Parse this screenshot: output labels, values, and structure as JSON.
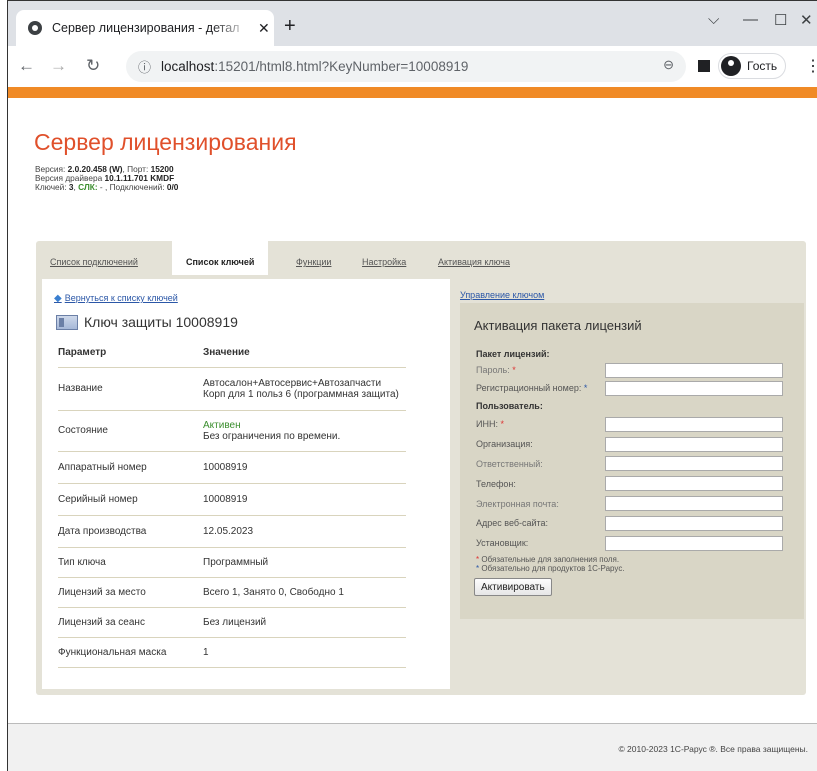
{
  "browser": {
    "tab_title": "Сервер лицензирования - детал",
    "tab_close": "✕",
    "new_tab": "+",
    "url_host": "localhost",
    "url_rest": ":15201/html8.html?KeyNumber=10008919",
    "profile_label": "Гость",
    "icons": [
      "globe-icon",
      "back-icon",
      "forward-icon",
      "reload-icon",
      "info-icon",
      "zoom-icon",
      "side-panel-icon",
      "avatar-icon",
      "menu-icon"
    ]
  },
  "header": {
    "title": "Сервер лицензирования",
    "version_label": "Версия: ",
    "version_value": "2.0.20.458 (W)",
    "port_label": ", Порт: ",
    "port_value": "15200",
    "driver_label": "Версия драйвера ",
    "driver_value": "10.1.11.701 KMDF",
    "keys_label": "Ключей: ",
    "keys_value": "3",
    "slk_label": "СЛК:",
    "slk_value": " - ",
    "conn_label": ", Подключений: ",
    "conn_value": "0/0"
  },
  "tabs": [
    {
      "label": "Список подключений"
    },
    {
      "label": "Список ключей"
    },
    {
      "label": "Функции"
    },
    {
      "label": "Настройка"
    },
    {
      "label": "Активация ключа"
    }
  ],
  "left": {
    "back_link": "Вернуться к списку ключей",
    "key_title": "Ключ защиты 10008919",
    "col_param": "Параметр",
    "col_value": "Значение",
    "rows": [
      {
        "k": "Название",
        "v": "Автосалон+Автосервис+Автозапчасти Корп для 1 польз 6 (программная защита)"
      },
      {
        "k": "Состояние",
        "v_status": "Активен",
        "v": "Без ограничения по времени."
      },
      {
        "k": "Аппаратный номер",
        "v": "10008919"
      },
      {
        "k": "Серийный номер",
        "v": "10008919"
      },
      {
        "k": "Дата производства",
        "v": "12.05.2023"
      },
      {
        "k": "Тип ключа",
        "v": "Программный"
      },
      {
        "k": "Лицензий за место",
        "v": "Всего 1, Занято 0, Свободно 1"
      },
      {
        "k": "Лицензий за сеанс",
        "v": "Без лицензий"
      },
      {
        "k": "Функциональная маска",
        "v": "1"
      }
    ]
  },
  "right": {
    "manage_link": "Управление ключом",
    "title": "Активация пакета лицензий",
    "section_package": "Пакет лицензий:",
    "password": "Пароль:",
    "reg_number": "Регистрационный номер:",
    "section_user": "Пользователь:",
    "inn": "ИНН:",
    "org": "Организация:",
    "responsible": "Ответственный:",
    "phone": "Телефон:",
    "email": "Электронная почта:",
    "website": "Адрес веб-сайта:",
    "installer": "Установщик:",
    "required_mark": "*",
    "note1": "Обязательные для заполнения поля.",
    "note2": "Обязательно для продуктов 1С-Рарус.",
    "button": "Активировать"
  },
  "footer": {
    "copyright": "© 2010-2023 1С-Рарус ®. Все права защищены."
  }
}
